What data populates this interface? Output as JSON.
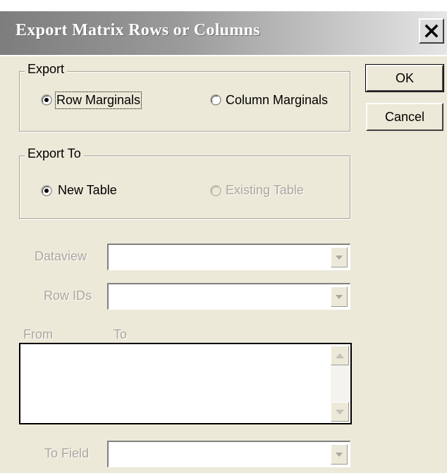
{
  "window": {
    "title": "Export Matrix Rows or Columns",
    "close_icon": "close-icon"
  },
  "export_group": {
    "legend": "Export",
    "options": [
      {
        "label": "Row Marginals",
        "selected": true,
        "enabled": true
      },
      {
        "label": "Column Marginals",
        "selected": false,
        "enabled": true
      }
    ]
  },
  "export_to_group": {
    "legend": "Export To",
    "options": [
      {
        "label": "New Table",
        "selected": true,
        "enabled": true
      },
      {
        "label": "Existing Table",
        "selected": false,
        "enabled": false
      }
    ]
  },
  "buttons": {
    "ok": "OK",
    "cancel": "Cancel"
  },
  "fields": {
    "dataview": {
      "label": "Dataview",
      "value": ""
    },
    "row_ids": {
      "label": "Row IDs",
      "value": ""
    },
    "to_field": {
      "label": "To Field",
      "value": ""
    }
  },
  "mapping_list": {
    "from_header": "From",
    "to_header": "To",
    "items": []
  }
}
